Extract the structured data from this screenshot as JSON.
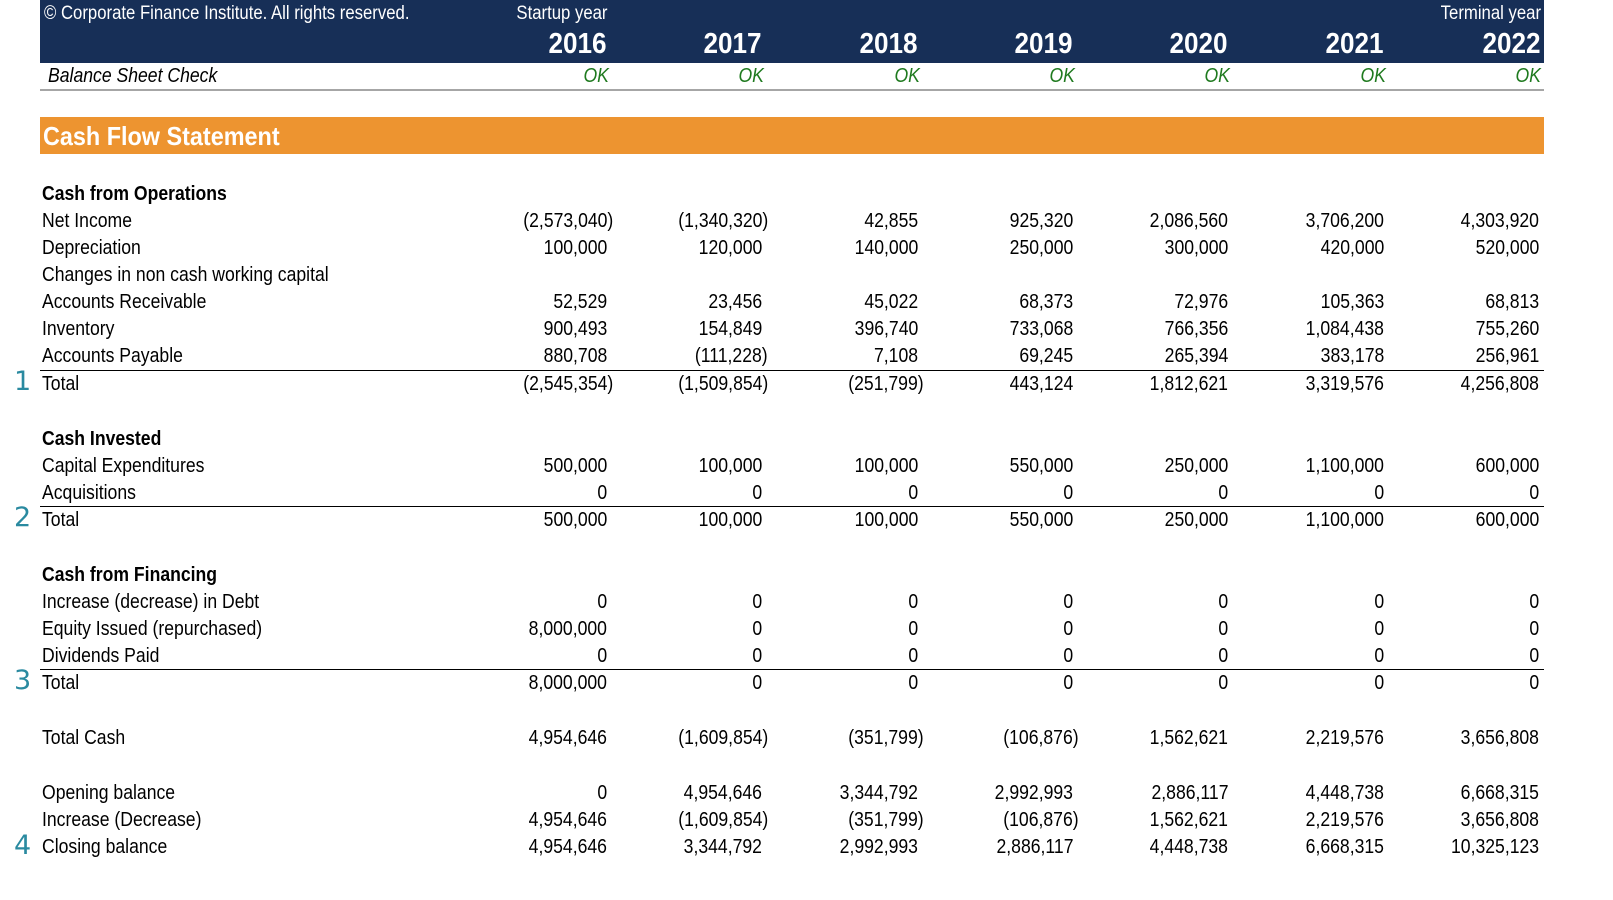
{
  "header": {
    "copyright": "© Corporate Finance Institute. All rights reserved.",
    "startup_label": "Startup year",
    "terminal_label": "Terminal year",
    "years": [
      "2016",
      "2017",
      "2018",
      "2019",
      "2020",
      "2021",
      "2022"
    ]
  },
  "balance_check": {
    "label": "Balance Sheet Check",
    "values": [
      "OK",
      "OK",
      "OK",
      "OK",
      "OK",
      "OK",
      "OK"
    ]
  },
  "section_title": "Cash Flow Statement",
  "colors": {
    "header_bg": "#172f57",
    "section_bg": "#ed9430",
    "ok_text": "#1f7a1f",
    "marker_text": "#2a8aa0"
  },
  "operations": {
    "heading": "Cash from Operations",
    "rows": [
      {
        "label": "Net Income",
        "values": [
          "(2,573,040)",
          "(1,340,320)",
          "42,855",
          "925,320",
          "2,086,560",
          "3,706,200",
          "4,303,920"
        ]
      },
      {
        "label": "Depreciation",
        "values": [
          "100,000",
          "120,000",
          "140,000",
          "250,000",
          "300,000",
          "420,000",
          "520,000"
        ]
      },
      {
        "label": "Changes in non cash working capital",
        "values": []
      },
      {
        "label": "Accounts Receivable",
        "values": [
          "52,529",
          "23,456",
          "45,022",
          "68,373",
          "72,976",
          "105,363",
          "68,813"
        ]
      },
      {
        "label": "Inventory",
        "values": [
          "900,493",
          "154,849",
          "396,740",
          "733,068",
          "766,356",
          "1,084,438",
          "755,260"
        ]
      },
      {
        "label": "Accounts Payable",
        "values": [
          "880,708",
          "(111,228)",
          "7,108",
          "69,245",
          "265,394",
          "383,178",
          "256,961"
        ]
      }
    ],
    "total": {
      "marker": "1",
      "label": "Total",
      "values": [
        "(2,545,354)",
        "(1,509,854)",
        "(251,799)",
        "443,124",
        "1,812,621",
        "3,319,576",
        "4,256,808"
      ]
    }
  },
  "invested": {
    "heading": "Cash Invested",
    "rows": [
      {
        "label": "Capital Expenditures",
        "values": [
          "500,000",
          "100,000",
          "100,000",
          "550,000",
          "250,000",
          "1,100,000",
          "600,000"
        ]
      },
      {
        "label": "Acquisitions",
        "values": [
          "0",
          "0",
          "0",
          "0",
          "0",
          "0",
          "0"
        ]
      }
    ],
    "total": {
      "marker": "2",
      "label": "Total",
      "values": [
        "500,000",
        "100,000",
        "100,000",
        "550,000",
        "250,000",
        "1,100,000",
        "600,000"
      ]
    }
  },
  "financing": {
    "heading": "Cash from Financing",
    "rows": [
      {
        "label": "Increase (decrease) in Debt",
        "values": [
          "0",
          "0",
          "0",
          "0",
          "0",
          "0",
          "0"
        ]
      },
      {
        "label": "Equity Issued (repurchased)",
        "values": [
          "8,000,000",
          "0",
          "0",
          "0",
          "0",
          "0",
          "0"
        ]
      },
      {
        "label": "Dividends Paid",
        "values": [
          "0",
          "0",
          "0",
          "0",
          "0",
          "0",
          "0"
        ]
      }
    ],
    "total": {
      "marker": "3",
      "label": "Total",
      "values": [
        "8,000,000",
        "0",
        "0",
        "0",
        "0",
        "0",
        "0"
      ]
    }
  },
  "total_cash": {
    "label": "Total Cash",
    "values": [
      "4,954,646",
      "(1,609,854)",
      "(351,799)",
      "(106,876)",
      "1,562,621",
      "2,219,576",
      "3,656,808"
    ]
  },
  "balances": {
    "rows": [
      {
        "label": "Opening balance",
        "values": [
          "0",
          "4,954,646",
          "3,344,792",
          "2,992,993",
          "2,886,117",
          "4,448,738",
          "6,668,315"
        ]
      },
      {
        "label": "Increase (Decrease)",
        "values": [
          "4,954,646",
          "(1,609,854)",
          "(351,799)",
          "(106,876)",
          "1,562,621",
          "2,219,576",
          "3,656,808"
        ]
      }
    ],
    "closing": {
      "marker": "4",
      "label": "Closing balance",
      "values": [
        "4,954,646",
        "3,344,792",
        "2,992,993",
        "2,886,117",
        "4,448,738",
        "6,668,315",
        "10,325,123"
      ]
    }
  }
}
